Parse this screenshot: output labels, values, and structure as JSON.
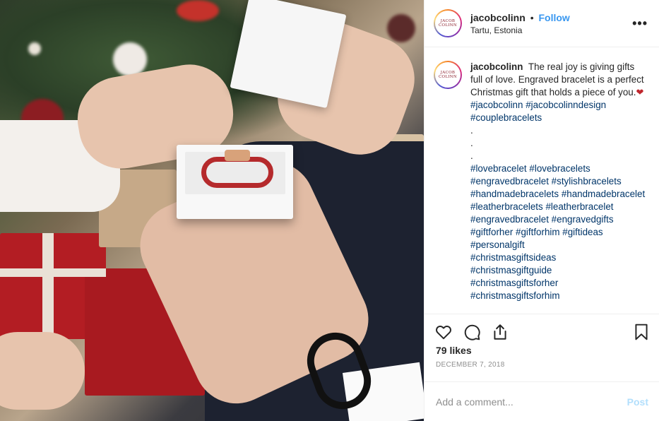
{
  "post": {
    "username": "jacobcolinn",
    "follow_label": "Follow",
    "separator": "•",
    "location": "Tartu, Estonia",
    "avatar_logo_line1": "JACOB",
    "avatar_logo_line2": "COLINN",
    "more_icon": "more-horizontal-icon"
  },
  "caption": {
    "username": "jacobcolinn",
    "text": "The real joy is giving gifts full of love. Engraved bracelet is a perfect Christmas gift that holds a piece of you.",
    "emoji": "❤",
    "first_tags": [
      "#jacobcolinn",
      "#jacobcolinndesign",
      "#couplebracelets"
    ],
    "dots": [
      ".",
      ".",
      "."
    ],
    "tags": [
      "#lovebracelet",
      "#lovebracelets",
      "#engravedbracelet",
      "#stylishbracelets",
      "#handmadebracelets",
      "#handmadebracelet",
      "#leatherbracelets",
      "#leatherbracelet",
      "#engravedbracelet",
      "#engravedgifts",
      "#giftforher",
      "#giftforhim",
      "#giftideas",
      "#personalgift",
      "#christmasgiftsideas",
      "#christmasgiftguide",
      "#christmasgiftsforher",
      "#christmasgiftsforhim"
    ]
  },
  "actions": {
    "like_icon": "heart-icon",
    "comment_icon": "comment-icon",
    "share_icon": "share-icon",
    "save_icon": "bookmark-icon"
  },
  "likes": "79 likes",
  "date": "DECEMBER 7, 2018",
  "comment": {
    "placeholder": "Add a comment...",
    "post_label": "Post"
  },
  "colors": {
    "link": "#3897f0",
    "hashtag": "#003569",
    "post_disabled": "#b2dffc"
  }
}
